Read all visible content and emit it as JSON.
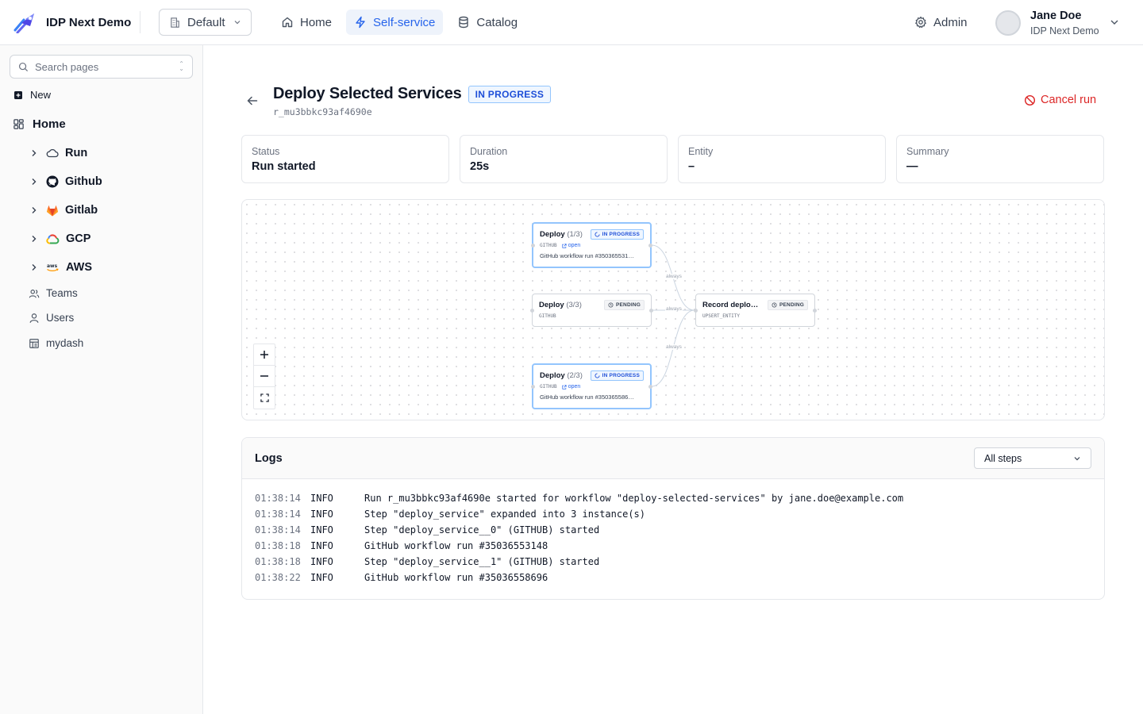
{
  "app": {
    "title": "IDP Next Demo"
  },
  "org_select": {
    "value": "Default"
  },
  "nav": [
    {
      "label": "Home",
      "icon": "home-icon"
    },
    {
      "label": "Self-service",
      "icon": "lightning-icon"
    },
    {
      "label": "Catalog",
      "icon": "database-icon"
    }
  ],
  "admin": {
    "label": "Admin"
  },
  "user": {
    "name": "Jane Doe",
    "org": "IDP Next Demo"
  },
  "sidebar": {
    "search_placeholder": "Search pages",
    "new_label": "New",
    "home_label": "Home",
    "items": [
      {
        "label": "Run",
        "icon": "cloud-icon"
      },
      {
        "label": "Github",
        "icon": "github-icon"
      },
      {
        "label": "Gitlab",
        "icon": "gitlab-icon"
      },
      {
        "label": "GCP",
        "icon": "gcp-icon"
      },
      {
        "label": "AWS",
        "icon": "aws-icon"
      }
    ],
    "links": [
      {
        "label": "Teams",
        "icon": "users-icon"
      },
      {
        "label": "Users",
        "icon": "user-icon"
      },
      {
        "label": "mydash",
        "icon": "dashboard-icon"
      }
    ]
  },
  "run": {
    "title": "Deploy Selected Services",
    "status_badge": "IN PROGRESS",
    "id": "r_mu3bbkc93af4690e",
    "cancel_label": "Cancel run"
  },
  "stats": [
    {
      "label": "Status",
      "value": "Run started"
    },
    {
      "label": "Duration",
      "value": "25s"
    },
    {
      "label": "Entity",
      "value": "–"
    },
    {
      "label": "Summary",
      "value": "—"
    }
  ],
  "graph": {
    "nodes": [
      {
        "title": "Deploy",
        "count": "(1/3)",
        "status": "IN PROGRESS",
        "type": "GITHUB",
        "link": "open",
        "desc": "GitHub workflow run #350365531…"
      },
      {
        "title": "Deploy",
        "count": "(3/3)",
        "status": "PENDING",
        "type": "GITHUB"
      },
      {
        "title": "Deploy",
        "count": "(2/3)",
        "status": "IN PROGRESS",
        "type": "GITHUB",
        "link": "open",
        "desc": "GitHub workflow run #350365586…"
      },
      {
        "title": "Record deplo…",
        "count": "",
        "status": "PENDING",
        "type": "UPSERT_ENTITY"
      }
    ],
    "edge_label": "always"
  },
  "logs": {
    "title": "Logs",
    "filter_value": "All steps",
    "lines": [
      {
        "ts": "01:38:14",
        "level": "INFO",
        "msg": "Run r_mu3bbkc93af4690e started for workflow \"deploy-selected-services\" by jane.doe@example.com"
      },
      {
        "ts": "01:38:14",
        "level": "INFO",
        "msg": "Step \"deploy_service\" expanded into 3 instance(s)"
      },
      {
        "ts": "01:38:14",
        "level": "INFO",
        "msg": "Step \"deploy_service__0\" (GITHUB) started"
      },
      {
        "ts": "01:38:18",
        "level": "INFO",
        "msg": "GitHub workflow run #35036553148"
      },
      {
        "ts": "01:38:18",
        "level": "INFO",
        "msg": "Step \"deploy_service__1\" (GITHUB) started"
      },
      {
        "ts": "01:38:22",
        "level": "INFO",
        "msg": "GitHub workflow run #35036558696"
      }
    ]
  },
  "colors": {
    "accent": "#2563eb",
    "danger": "#dc2626",
    "badge_bg": "#eff6ff"
  }
}
